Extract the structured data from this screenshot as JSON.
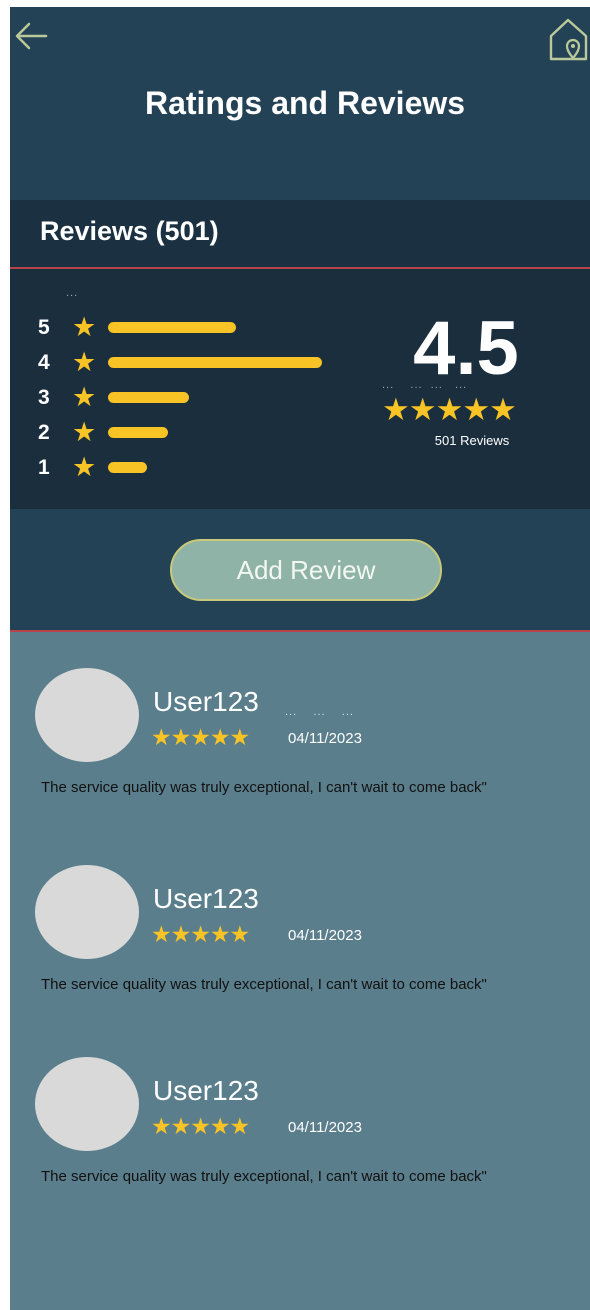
{
  "header": {
    "title": "Ratings and Reviews",
    "back_icon": "arrow-left-icon",
    "home_icon": "home-location-icon"
  },
  "reviews_bar": {
    "label": "Reviews (501)"
  },
  "summary": {
    "breakdown": [
      {
        "stars": "5",
        "fill_fraction": 0.6
      },
      {
        "stars": "4",
        "fill_fraction": 1.0
      },
      {
        "stars": "3",
        "fill_fraction": 0.38
      },
      {
        "stars": "2",
        "fill_fraction": 0.28
      },
      {
        "stars": "1",
        "fill_fraction": 0.18
      }
    ],
    "average": "4.5",
    "average_stars": "★★★★★",
    "count_text": "501 Reviews",
    "star_glyph": "★"
  },
  "actions": {
    "add_review_label": "Add Review"
  },
  "reviews": [
    {
      "user": "User123",
      "stars": "★★★★★",
      "date": "04/11/2023",
      "text": "The service quality was truly exceptional, I can't wait to come back\""
    },
    {
      "user": "User123",
      "stars": "★★★★★",
      "date": "04/11/2023",
      "text": "The service quality was truly exceptional, I can't wait to come back\""
    },
    {
      "user": "User123",
      "stars": "★★★★★",
      "date": "04/11/2023",
      "text": "The service quality was truly exceptional, I can't wait to come back\""
    }
  ],
  "colors": {
    "header_bg": "#244256",
    "summary_bg": "#1b2e3e",
    "list_bg": "#5a7e8c",
    "star": "#f7c325",
    "divider": "#b8434a",
    "button_bg": "#8fb3a6"
  }
}
